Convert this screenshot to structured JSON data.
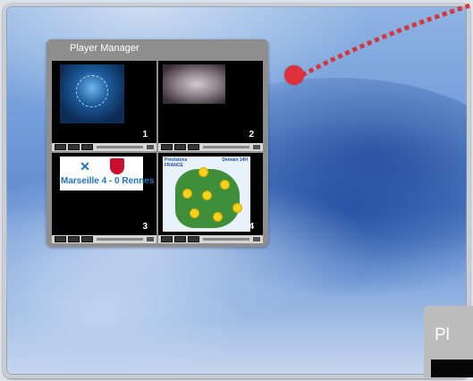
{
  "player_manager": {
    "title": "Player Manager",
    "players": [
      {
        "number": "1",
        "content": "book-cover-video"
      },
      {
        "number": "2",
        "content": "closeup-video"
      },
      {
        "number": "3",
        "content": "football-score",
        "score_text": "Marseille 4 - 0 Rennes"
      },
      {
        "number": "4",
        "content": "weather-map",
        "title_line1": "Prévisions",
        "title_line2": "FRANCE",
        "date_label": "Demain 14H"
      }
    ]
  },
  "side_tab": {
    "label_visible": "Pl"
  },
  "colors": {
    "panel": "#8e8e8e",
    "accent_dot": "#e0303a",
    "desktop": "#6f9ad8"
  },
  "icons": [
    "play-button-icon",
    "stop-button-icon",
    "volume-slider-icon"
  ]
}
